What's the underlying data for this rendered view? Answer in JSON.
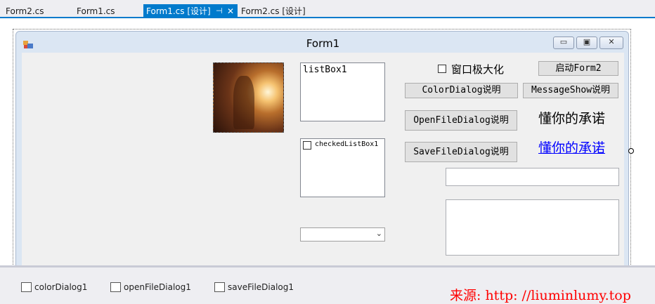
{
  "tabs": [
    {
      "label": "Form2.cs",
      "active": false
    },
    {
      "label": "Form1.cs",
      "active": false
    },
    {
      "label": "Form1.cs [设计]",
      "active": true
    },
    {
      "label": "Form2.cs [设计]",
      "active": false
    }
  ],
  "form": {
    "title": "Form1",
    "minimize_glyph": "▭",
    "maximize_glyph": "▣",
    "close_glyph": "✕"
  },
  "controls": {
    "listbox_label": "listBox1",
    "checkedlistbox_item": "checkedListBox1",
    "checkbox_label": "窗口极大化",
    "launch_form2": "启动Form2",
    "color_dialog": "ColorDialog说明",
    "message_show": "MessageShow说明",
    "open_file_dialog": "OpenFileDialog说明",
    "save_file_dialog": "SaveFileDialog说明",
    "label_text": "懂你的承诺",
    "link_text": "懂你的承诺",
    "combo_value": "",
    "textbox_value": "",
    "textarea_value": ""
  },
  "tray": {
    "items": [
      "colorDialog1",
      "openFileDialog1",
      "saveFileDialog1"
    ]
  },
  "watermark": "来源: http: //liuminlumy.top",
  "colors": {
    "accent": "#007acc",
    "link": "#0000ff",
    "watermark": "#ff0000"
  },
  "icons": {
    "tab_pin": "pin-icon",
    "tab_close": "close-icon",
    "form_icon": "form-icon",
    "tray_color": "color-dialog-icon",
    "tray_open": "open-file-dialog-icon",
    "tray_save": "save-file-dialog-icon"
  }
}
